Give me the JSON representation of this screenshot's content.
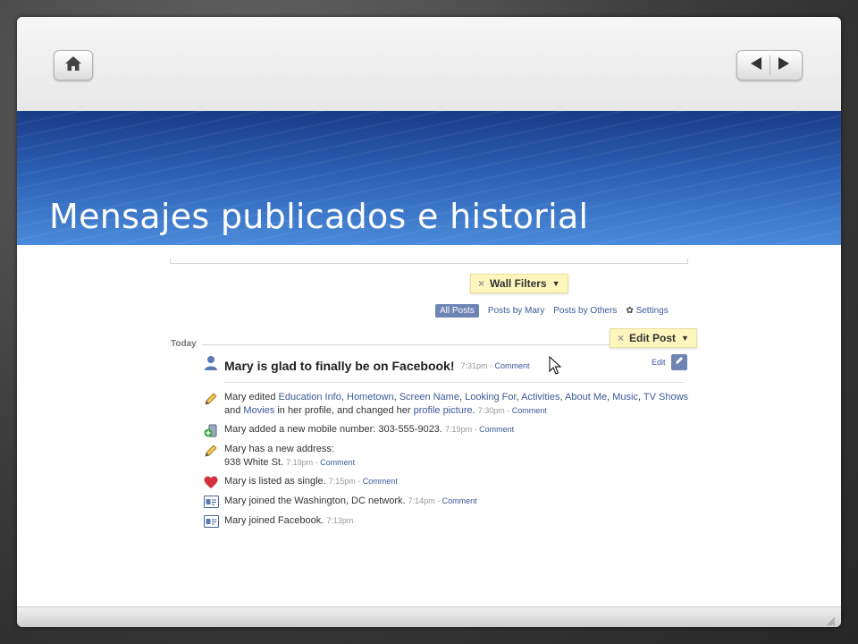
{
  "slide": {
    "title": "Mensajes publicados e historial"
  },
  "colors": {
    "banner_top": "#1a3c87",
    "banner_bottom": "#4a8ad9",
    "link_blue": "#3b5998",
    "tooltip_yellow": "#fff6bd"
  },
  "icons": {
    "home": "home-icon",
    "prev": "arrow-left-icon",
    "next": "arrow-right-icon"
  },
  "screenshot": {
    "wall_filters": {
      "close": "×",
      "label": "Wall Filters"
    },
    "tabs": [
      "All Posts",
      "Posts by Mary",
      "Posts by Others",
      "Settings"
    ],
    "today": "Today",
    "edit_post": {
      "close": "×",
      "label": "Edit Post"
    },
    "status": {
      "text": "Mary is glad to finally be on Facebook!",
      "time": "7:31pm",
      "separator": " - ",
      "comment": "Comment",
      "edit": "Edit"
    },
    "feed": [
      {
        "icon": "pencil-icon",
        "parts": [
          {
            "t": "Mary edited "
          },
          {
            "t": "Education Info",
            "link": true
          },
          {
            "t": ", "
          },
          {
            "t": "Hometown",
            "link": true
          },
          {
            "t": ", "
          },
          {
            "t": "Screen Name",
            "link": true
          },
          {
            "t": ", "
          },
          {
            "t": "Looking For",
            "link": true
          },
          {
            "t": ", "
          },
          {
            "t": "Activities",
            "link": true
          },
          {
            "t": ", "
          },
          {
            "t": "About Me",
            "link": true
          },
          {
            "t": ", "
          },
          {
            "t": "Music",
            "link": true
          },
          {
            "t": ", "
          },
          {
            "t": "TV Shows",
            "link": true
          },
          {
            "t": " and "
          },
          {
            "t": "Movies",
            "link": true
          },
          {
            "t": " in her profile, and changed her "
          },
          {
            "t": "profile picture",
            "link": true
          },
          {
            "t": ". "
          }
        ],
        "time": "7:30pm",
        "comment": "Comment"
      },
      {
        "icon": "phone-add-icon",
        "parts": [
          {
            "t": "Mary added a new mobile number: 303-555-9023. "
          }
        ],
        "time": "7:19pm",
        "comment": "Comment"
      },
      {
        "icon": "pencil-icon",
        "parts": [
          {
            "t": "Mary has a new address:"
          },
          {
            "br": true
          },
          {
            "t": "938 White St. "
          }
        ],
        "time": "7:19pm",
        "comment": "Comment"
      },
      {
        "icon": "heart-icon",
        "parts": [
          {
            "t": "Mary is listed as single. "
          }
        ],
        "time": "7:15pm",
        "comment": "Comment"
      },
      {
        "icon": "id-card-icon",
        "parts": [
          {
            "t": "Mary joined the Washington, DC network. "
          }
        ],
        "time": "7:14pm",
        "comment": "Comment"
      },
      {
        "icon": "id-card-icon",
        "parts": [
          {
            "t": "Mary joined Facebook. "
          }
        ],
        "time": "7:13pm",
        "comment": ""
      }
    ]
  }
}
